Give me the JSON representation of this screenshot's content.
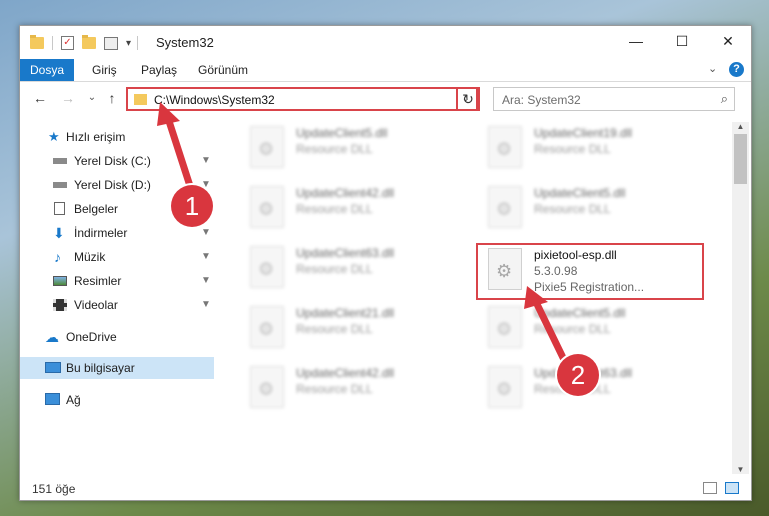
{
  "window": {
    "title": "System32",
    "minimize": "—",
    "maximize": "☐",
    "close": "✕"
  },
  "ribbon": {
    "file_tab": "Dosya",
    "tabs": [
      "Giriş",
      "Paylaş",
      "Görünüm"
    ],
    "help": "?",
    "collapse": "⌄"
  },
  "nav": {
    "back": "←",
    "forward": "→",
    "recent": "⌄",
    "up": "↑",
    "address": "C:\\Windows\\System32",
    "address_dropdown": "⌄",
    "refresh": "↻",
    "search_placeholder": "Ara: System32",
    "search_icon": "⌕"
  },
  "sidebar": {
    "items": [
      {
        "label": "Hızlı erişim",
        "icon": "star-icon"
      },
      {
        "label": "Yerel Disk (C:)",
        "icon": "drive-icon",
        "pinned": true
      },
      {
        "label": "Yerel Disk (D:)",
        "icon": "drive-icon",
        "pinned": true
      },
      {
        "label": "Belgeler",
        "icon": "document-icon",
        "pinned": true
      },
      {
        "label": "İndirmeler",
        "icon": "download-icon",
        "pinned": true
      },
      {
        "label": "Müzik",
        "icon": "music-icon",
        "pinned": true
      },
      {
        "label": "Resimler",
        "icon": "picture-icon",
        "pinned": true
      },
      {
        "label": "Videolar",
        "icon": "video-icon",
        "pinned": true
      },
      {
        "label": "OneDrive",
        "icon": "cloud-icon"
      },
      {
        "label": "Bu bilgisayar",
        "icon": "computer-icon",
        "selected": true
      },
      {
        "label": "Ağ",
        "icon": "network-icon"
      }
    ],
    "pin_glyph": "📌"
  },
  "files": [
    {
      "name": "UpdateClient5.dll",
      "type": "Resource DLL"
    },
    {
      "name": "UpdateClient19.dll",
      "type": "Resource DLL"
    },
    {
      "name": "UpdateClient42.dll",
      "type": "Resource DLL"
    },
    {
      "name": "UpdateClient5.dll",
      "type": "Resource DLL"
    },
    {
      "name": "UpdateClient63.dll",
      "type": "Resource DLL"
    },
    {
      "name": "pixietool-esp.dll",
      "type": "5.3.0.98",
      "desc": "Pixie5 Registration..."
    },
    {
      "name": "UpdateClient21.dll",
      "type": "Resource DLL"
    },
    {
      "name": "UpdateClient5.dll",
      "type": "Resource DLL"
    },
    {
      "name": "UpdateClient42.dll",
      "type": "Resource DLL"
    },
    {
      "name": "UpdateClient63.dll",
      "type": "Resource DLL"
    }
  ],
  "status": {
    "count": "151 öğe"
  },
  "callouts": {
    "one": "1",
    "two": "2"
  },
  "colors": {
    "accent": "#1979ca",
    "highlight": "#d9444a",
    "badge": "#d9363e"
  }
}
